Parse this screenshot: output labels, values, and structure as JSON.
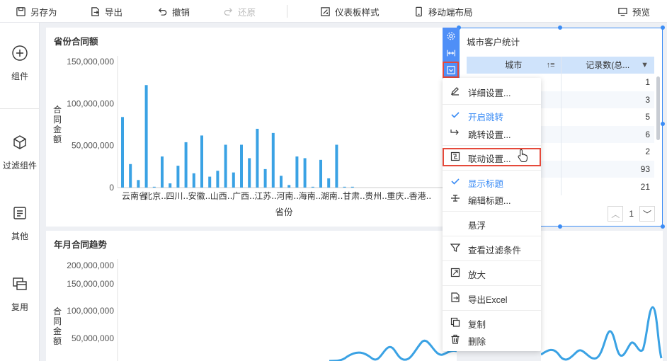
{
  "toolbar": {
    "save_as": "另存为",
    "export": "导出",
    "undo": "撤销",
    "redo": "还原",
    "dashboard_style": "仪表板样式",
    "mobile_layout": "移动端布局",
    "preview": "预览"
  },
  "leftnav": [
    {
      "label": "组件",
      "icon": "plus-circle-icon"
    },
    {
      "label": "过滤组件",
      "icon": "cube-icon"
    },
    {
      "label": "其他",
      "icon": "document-icon"
    },
    {
      "label": "复用",
      "icon": "copy-layers-icon"
    }
  ],
  "bar_widget": {
    "title": "省份合同额"
  },
  "line_widget": {
    "title": "年月合同趋势"
  },
  "table_widget": {
    "title": "城市客户统计",
    "col1": "城市",
    "col2": "记录数(总...",
    "rows": [
      "1",
      "3",
      "5",
      "6",
      "2",
      "93",
      "21"
    ],
    "page": "1"
  },
  "context_menu": {
    "detail_settings": "详细设置...",
    "enable_jump": "开启跳转",
    "jump_settings": "跳转设置...",
    "linkage_settings": "联动设置...",
    "show_title": "显示标题",
    "edit_title": "编辑标题...",
    "float": "悬浮",
    "view_filter": "查看过滤条件",
    "zoom": "放大",
    "export_excel": "导出Excel",
    "copy": "复制",
    "delete": "删除"
  },
  "chart_data": [
    {
      "type": "bar",
      "title": "省份合同额",
      "xlabel": "省份",
      "ylabel": "合同金额",
      "ylim": [
        0,
        150000000
      ],
      "yticks": [
        "150,000,000",
        "100,000,000",
        "50,000,000",
        "0"
      ],
      "categories": [
        "云南省",
        "北京..",
        "四川..",
        "安徽..",
        "山西..",
        "广西..",
        "江苏..",
        "河南..",
        "海南..",
        "湖南..",
        "甘肃..",
        "贵州..",
        "重庆..",
        "香港.."
      ],
      "values": [
        84000000,
        28000000,
        9000000,
        122000000,
        1000000,
        37000000,
        5000000,
        26000000,
        54000000,
        17000000,
        62000000,
        13000000,
        20000000,
        51000000,
        18000000,
        51000000,
        35000000,
        70000000,
        22000000,
        65000000,
        14000000,
        3000000,
        37000000,
        35000000,
        1000000,
        33000000,
        11000000,
        51000000,
        1000000,
        1000000
      ],
      "color": "#3aa2e4"
    },
    {
      "type": "line",
      "title": "年月合同趋势",
      "ylabel": "合同金额",
      "ylim": [
        0,
        200000000
      ],
      "yticks": [
        "200,000,000",
        "150,000,000",
        "100,000,000",
        "50,000,000"
      ],
      "color": "#3aa2e4"
    }
  ],
  "colors": {
    "accent": "#3b8cf5",
    "highlight": "#e5493a",
    "bar": "#3aa2e4",
    "header_bg": "#cfe3fb"
  }
}
